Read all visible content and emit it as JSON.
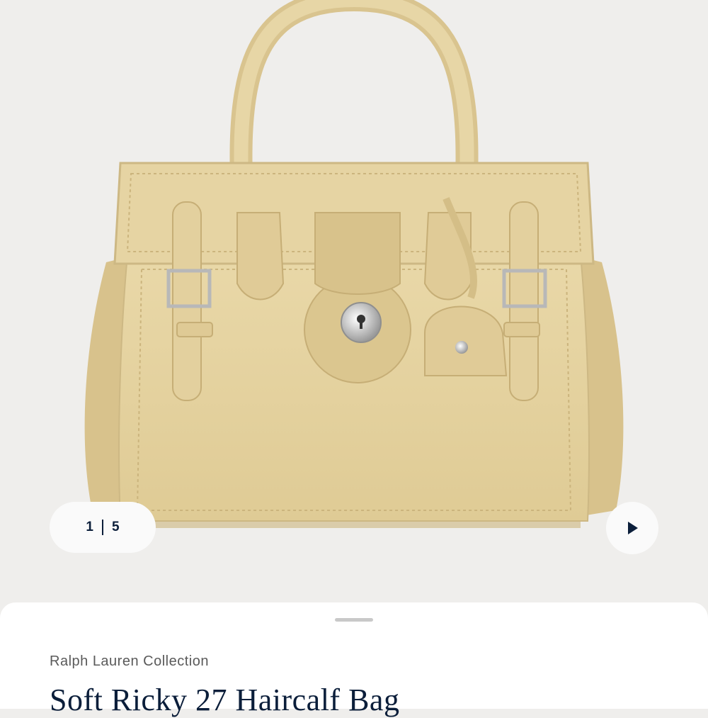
{
  "gallery": {
    "image_icon": "handbag-product-image",
    "current_index": "1",
    "total_count": "5",
    "next_icon": "play-arrow-icon"
  },
  "product": {
    "brand": "Ralph Lauren Collection",
    "title": "Soft Ricky 27 Haircalf Bag"
  },
  "colors": {
    "background": "#efeeec",
    "bag_leather": "#e2cf9c",
    "text_dark": "#0b1e3a",
    "sheet": "#ffffff"
  }
}
